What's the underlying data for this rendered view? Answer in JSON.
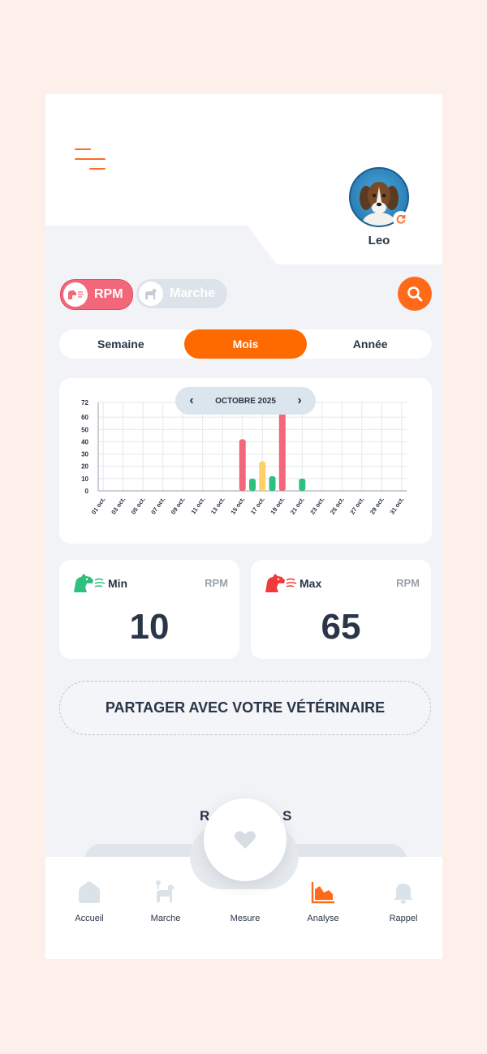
{
  "pet": {
    "name": "Leo"
  },
  "toggles": {
    "rpm_label": "RPM",
    "marche_label": "Marche"
  },
  "period_tabs": {
    "week": "Semaine",
    "month": "Mois",
    "year": "Année",
    "active": "Mois"
  },
  "chart_nav": {
    "label": "OCTOBRE 2025",
    "prev": "‹",
    "next": "›"
  },
  "chart_data": {
    "type": "bar",
    "title": "",
    "y_ticks": [
      "72",
      "60",
      "50",
      "40",
      "30",
      "20",
      "10",
      "0"
    ],
    "ylim": [
      0,
      72
    ],
    "x_tick_labels": [
      "01 oct.",
      "03 oct.",
      "05 oct.",
      "07 oct.",
      "09 oct.",
      "11 oct.",
      "13 oct.",
      "15 oct.",
      "17 oct.",
      "19 oct.",
      "21 oct.",
      "23 oct.",
      "25 oct.",
      "27 oct.",
      "29 oct.",
      "31 oct."
    ],
    "grid": true,
    "bars": [
      {
        "day": 15,
        "value": 42,
        "color": "#f2687a"
      },
      {
        "day": 16,
        "value": 10,
        "color": "#2fbf7f"
      },
      {
        "day": 17,
        "value": 24,
        "color": "#ffd166"
      },
      {
        "day": 18,
        "value": 12,
        "color": "#2fbf7f"
      },
      {
        "day": 19,
        "value": 65,
        "color": "#f2687a"
      },
      {
        "day": 21,
        "value": 10,
        "color": "#2fbf7f"
      }
    ]
  },
  "stats": {
    "min": {
      "title": "Min",
      "unit": "RPM",
      "value": "10"
    },
    "max": {
      "title": "Max",
      "unit": "RPM",
      "value": "65"
    }
  },
  "share_label": "PARTAGER AVEC VOTRE VÉTÉRINAIRE",
  "hidden_section": {
    "left": "R",
    "right": "S"
  },
  "nav": {
    "items": [
      {
        "label": "Accueil"
      },
      {
        "label": "Marche"
      },
      {
        "label": "Mesure"
      },
      {
        "label": "Analyse"
      },
      {
        "label": "Rappel"
      }
    ],
    "active": "Analyse"
  },
  "colors": {
    "accent": "#ff6a00",
    "rpm_red": "#f2687a",
    "green": "#2fbf7f",
    "yellow": "#ffd166",
    "text": "#2a3547"
  }
}
